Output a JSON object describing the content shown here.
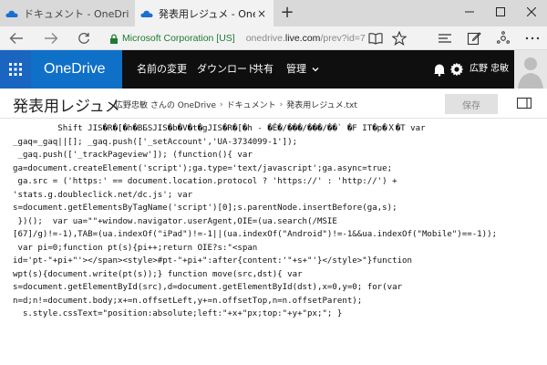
{
  "browser": {
    "tabs": [
      {
        "label": "ドキュメント - OneDrive",
        "active": false
      },
      {
        "label": "発表用レジュメ - OneDrive",
        "active": true
      }
    ],
    "new_tab": "+",
    "close_glyph": "×",
    "address": {
      "cert": "Microsoft Corporation [US]",
      "url_prefix": "onedrive.",
      "url_domain": "live.com",
      "url_path": "/prev?id=7"
    }
  },
  "suite": {
    "brand": "OneDrive",
    "commands": [
      "名前の変更",
      "ダウンロード",
      "共有",
      "管理"
    ],
    "username": "広野 忠敏",
    "colors": {
      "bar": "#0f0f0f",
      "brand": "#0f70c8",
      "waffle": "#1a65c0"
    }
  },
  "document": {
    "title": "発表用レジュメ",
    "breadcrumb": [
      "広野忠敏 さんの OneDrive",
      "ドキュメント",
      "発表用レジュメ.txt"
    ],
    "breadcrumb_sep": "›",
    "save_label": "保存"
  },
  "editor": {
    "lines": [
      "         Shift JIS�R�[�h�BБSJIS�b�V�t�gJIS�R�[�h - �Ê�/���/���/��` �F IT�p�Ｘ�T var",
      "_gaq=_gaq||[]; _gaq.push(['_setAccount','UA-3734099-1']);",
      " _gaq.push(['_trackPageview']); (function(){ var",
      "ga=document.createElement('script');ga.type='text/javascript';ga.async=true;",
      " ga.src = ('https:' == document.location.protocol ? 'https://' : 'http://') +",
      "'stats.g.doubleclick.net/dc.js'; var",
      "s=document.getElementsByTagName('script')[0];s.parentNode.insertBefore(ga,s);",
      " })();  var ua=\"\"+window.navigator.userAgent,OIE=(ua.search(/MSIE",
      "[67]/g)!=-1),TAB=(ua.indexOf(\"iPad\")!=-1||(ua.indexOf(\"Android\")!=-1&&ua.indexOf(\"Mobile\")==-1));",
      " var pi=0;function pt(s){pi++;return OIE?s:\"<span",
      "id='pt-\"+pi+\"'></span><style>#pt-\"+pi+\":after{content:'\"+s+\"'}</style>\"}function",
      "wpt(s){document.write(pt(s));} function move(src,dst){ var",
      "s=document.getElementById(src),d=document.getElementById(dst),x=0,y=0; for(var",
      "n=d;n!=document.body;x+=n.offsetLeft,y+=n.offsetTop,n=n.offsetParent);",
      "  s.style.cssText=\"position:absolute;left:\"+x+\"px;top:\"+y+\"px;\"; }"
    ]
  }
}
